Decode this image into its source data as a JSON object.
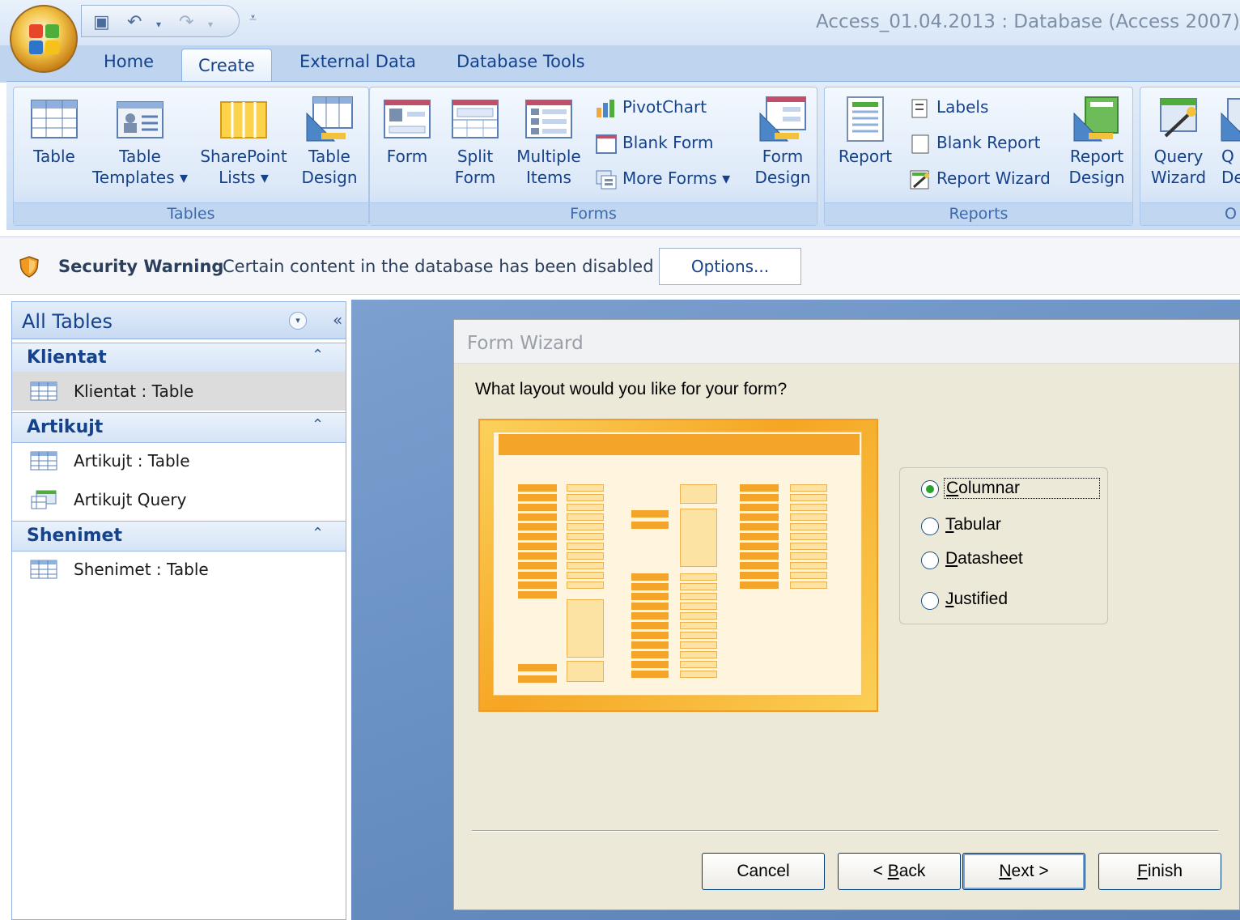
{
  "window": {
    "title": "Access_01.04.2013 : Database (Access 2007) -"
  },
  "quick_access": {
    "save_icon": "save-icon",
    "undo_icon": "undo-icon",
    "redo_icon": "redo-icon",
    "customize_icon": "customize-qat-icon"
  },
  "tabs": [
    {
      "label": "Home",
      "active": false
    },
    {
      "label": "Create",
      "active": true
    },
    {
      "label": "External Data",
      "active": false
    },
    {
      "label": "Database Tools",
      "active": false
    }
  ],
  "ribbon": {
    "tables": {
      "label": "Tables",
      "table": "Table",
      "table_templates": [
        "Table",
        "Templates ▾"
      ],
      "sharepoint_lists": [
        "SharePoint",
        "Lists ▾"
      ],
      "table_design": [
        "Table",
        "Design"
      ]
    },
    "forms": {
      "label": "Forms",
      "form": "Form",
      "split_form": [
        "Split",
        "Form"
      ],
      "multiple_items": [
        "Multiple",
        "Items"
      ],
      "pivotchart": "PivotChart",
      "blank_form": "Blank Form",
      "more_forms": "More Forms ▾",
      "form_design": [
        "Form",
        "Design"
      ]
    },
    "reports": {
      "label": "Reports",
      "report": "Report",
      "labels": "Labels",
      "blank_report": "Blank Report",
      "report_wizard": "Report Wizard",
      "report_design": [
        "Report",
        "Design"
      ]
    },
    "other": {
      "label": "O",
      "query_wizard": [
        "Query",
        "Wizard"
      ],
      "query_design": [
        "Q",
        "De"
      ]
    }
  },
  "security_bar": {
    "title": "Security Warning",
    "message": "Certain content in the database has been disabled",
    "options_button": "Options..."
  },
  "nav_pane": {
    "title": "All Tables",
    "collapse_glyph": "«",
    "dropdown_glyph": "▾",
    "groups": [
      {
        "label": "Klientat",
        "chevron": "⌃",
        "items": [
          {
            "label": "Klientat : Table",
            "type": "table",
            "selected": true
          }
        ]
      },
      {
        "label": "Artikujt",
        "chevron": "⌃",
        "items": [
          {
            "label": "Artikujt : Table",
            "type": "table"
          },
          {
            "label": "Artikujt Query",
            "type": "query"
          }
        ]
      },
      {
        "label": "Shenimet",
        "chevron": "⌃",
        "items": [
          {
            "label": "Shenimet : Table",
            "type": "table"
          }
        ]
      }
    ]
  },
  "dialog": {
    "title": "Form Wizard",
    "question": "What layout would you like for your form?",
    "layout_options": [
      {
        "key": "C",
        "rest": "olumnar",
        "selected": true
      },
      {
        "key": "T",
        "rest": "abular",
        "selected": false
      },
      {
        "key": "D",
        "rest": "atasheet",
        "selected": false
      },
      {
        "key": "J",
        "rest": "ustified",
        "selected": false
      }
    ],
    "buttons": {
      "cancel": "Cancel",
      "back": {
        "pre": "< ",
        "key": "B",
        "rest": "ack"
      },
      "next": {
        "key": "N",
        "rest": "ext >"
      },
      "finish": {
        "key": "F",
        "rest": "inish"
      }
    }
  },
  "colors": {
    "accent_orange": "#f5a42a",
    "ribbon_text": "#15428b",
    "selected_radio": "#2da12d"
  }
}
